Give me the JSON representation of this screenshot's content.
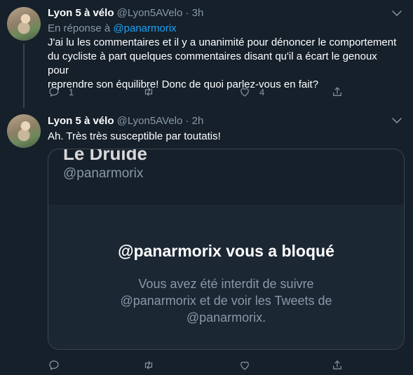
{
  "tweets": [
    {
      "display_name": "Lyon 5 à vélo",
      "handle": "@Lyon5AVelo",
      "separator": "·",
      "time": "3h",
      "reply_prefix": "En réponse à",
      "reply_mention": "@panarmorix",
      "text_lines": [
        "J'ai lu les commentaires et il y a unanimité pour dénoncer le comportement",
        "du cycliste à part quelques commentaires disant qu'il a écart le genoux pour",
        "reprendre son équilibre! Donc de quoi parlez-vous en fait?"
      ],
      "reply_count": "1",
      "retweet_count": "",
      "like_count": "4"
    },
    {
      "display_name": "Lyon 5 à vélo",
      "handle": "@Lyon5AVelo",
      "separator": "·",
      "time": "2h",
      "text": "Ah. Très très susceptible par toutatis!",
      "reply_count": "",
      "retweet_count": "",
      "like_count": ""
    }
  ],
  "blocked_card": {
    "name": "Le Druide",
    "handle": "@panarmorix",
    "title": "@panarmorix vous a bloqué",
    "desc_lines": [
      "Vous avez été interdit de suivre",
      "@panarmorix et de voir les Tweets de",
      "@panarmorix."
    ]
  },
  "colors": {
    "background": "#15202b",
    "secondary_text": "#8899a6",
    "accent": "#1da1f2",
    "border": "#38444d"
  },
  "icons": [
    "caret-down-icon",
    "reply-icon",
    "retweet-icon",
    "like-icon",
    "share-icon"
  ]
}
